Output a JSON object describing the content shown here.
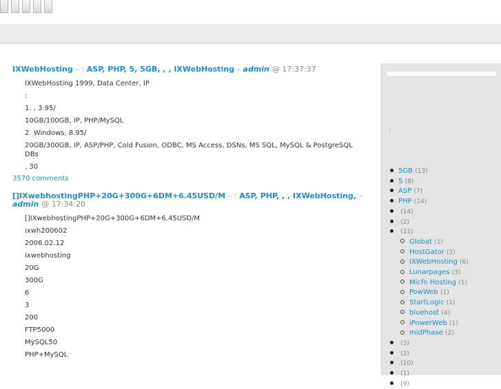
{
  "nav": {
    "tabs": [
      "",
      "",
      "",
      "",
      ""
    ]
  },
  "header": {
    "title": ""
  },
  "posts": [
    {
      "title_link": "IXWebHosting",
      "sep1": " – ",
      "cat_label": ":",
      "categories": "ASP, PHP, 5, 5GB, , , IXWebHosting",
      "sep2": " – ",
      "author": "admin",
      "at": "@ 17:37:37",
      "lines": [
        "IXWebHosting 1999, Data Center, IP",
        ":",
        "1. , 3.95/ ",
        " 10GB/100GB, IP, PHP/MySQL",
        "2. Windows, 8.95/ ",
        " 20GB/300GB, IP, ASP/PHP, Cold Fusion, ODBC, MS Access, DSNs, MS SQL, MySQL & PostgreSQL DBs",
        ", 30"
      ],
      "comments": "3570 comments"
    },
    {
      "title_link": "[]IXwebhostingPHP+20G+300G+6DM+6.45USD/M",
      "sep1": " – ",
      "cat_label": ":",
      "categories": "ASP, PHP, , , IXWebHosting, ",
      "sep2": " – ",
      "author": "admin",
      "at": "@ 17:34:20",
      "lines": [
        "[]IXwebhostingPHP+20G+300G+6DM+6.45USD/M",
        "ixwh200602",
        "2006.02.12",
        "ixwebhosting",
        "20G",
        "300G",
        "6",
        "3",
        "200",
        "FTP5000",
        "MySQL50",
        "PHP+MySQL"
      ]
    }
  ],
  "sidebar": {
    "intro": "",
    "heading": ":",
    "link_a": "",
    "link_b": "",
    "categories": [
      {
        "label": "5GB",
        "count": "(13)",
        "child": false
      },
      {
        "label": "5",
        "count": "(8)",
        "child": false
      },
      {
        "label": "ASP",
        "count": "(7)",
        "child": false
      },
      {
        "label": "PHP",
        "count": "(14)",
        "child": false
      },
      {
        "label": "",
        "count": "(14)",
        "child": false
      },
      {
        "label": "",
        "count": "(2)",
        "child": false
      },
      {
        "label": "",
        "count": "(11)",
        "child": false
      },
      {
        "label": "Globat",
        "count": "(1)",
        "child": true
      },
      {
        "label": "HostGator",
        "count": "(5)",
        "child": true
      },
      {
        "label": "IXWebHosting",
        "count": "(6)",
        "child": true
      },
      {
        "label": "Lunarpages",
        "count": "(3)",
        "child": true
      },
      {
        "label": "Micfo Hosting",
        "count": "(1)",
        "child": true
      },
      {
        "label": "PowWeb",
        "count": "(1)",
        "child": true
      },
      {
        "label": "StartLogic",
        "count": "(1)",
        "child": true
      },
      {
        "label": "bluehost",
        "count": "(4)",
        "child": true
      },
      {
        "label": "iPowerWeb",
        "count": "(1)",
        "child": true
      },
      {
        "label": "midPhase",
        "count": "(2)",
        "child": true
      },
      {
        "label": "",
        "count": "(3)",
        "child": false
      },
      {
        "label": "",
        "count": "(2)",
        "child": false
      },
      {
        "label": "",
        "count": "(10)",
        "child": false
      },
      {
        "label": "",
        "count": "(1)",
        "child": false
      },
      {
        "label": "",
        "count": "(9)",
        "child": false
      }
    ]
  }
}
